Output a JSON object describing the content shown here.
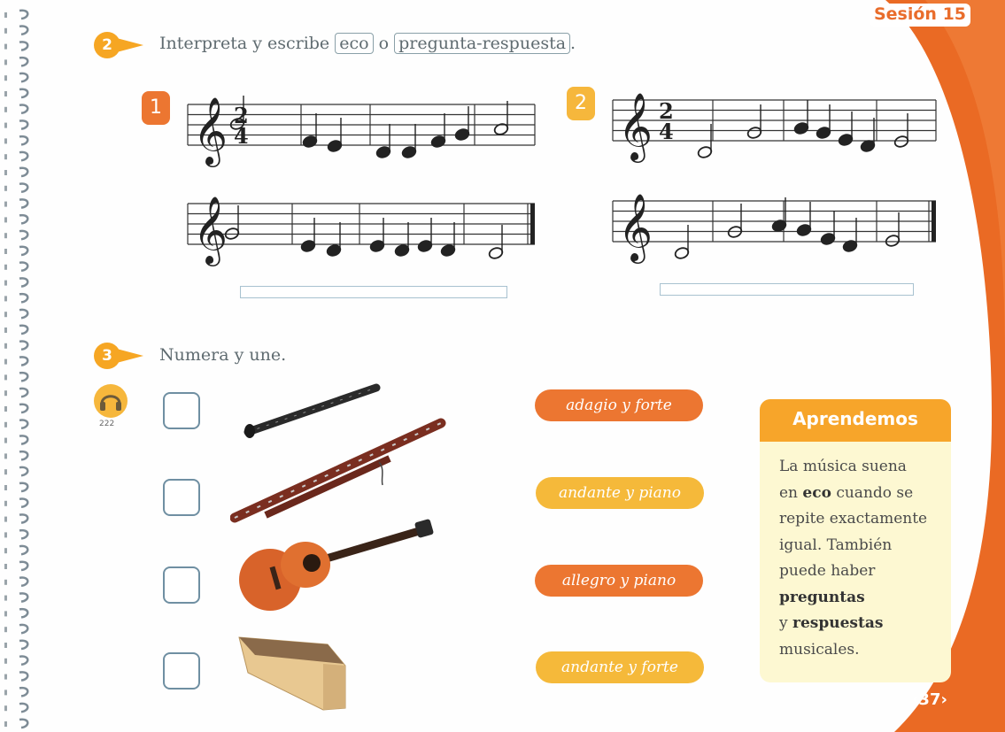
{
  "session_label": "Sesión 15",
  "activity2": {
    "number": "2",
    "instruction_prefix": "Interpreta y escribe",
    "option_eco": "eco",
    "conjunction": "o",
    "option_qa": "pregunta-respuesta",
    "instruction_suffix": ".",
    "exercises": [
      {
        "number": "1"
      },
      {
        "number": "2"
      }
    ],
    "time_signature_top": "2",
    "time_signature_bottom": "4"
  },
  "activity3": {
    "number": "3",
    "instruction": "Numera y une.",
    "track": "222",
    "instruments": [
      {
        "name": "clarinet-image"
      },
      {
        "name": "bassoon-image"
      },
      {
        "name": "guitar-image"
      },
      {
        "name": "xylophone-image"
      }
    ],
    "tempo_labels": [
      "adagio y forte",
      "andante y piano",
      "allegro y piano",
      "andante y forte"
    ]
  },
  "aprendemos": {
    "title": "Aprendemos",
    "t1": "La música suena",
    "t2a": "en ",
    "t2b": "eco",
    "t2c": " cuando se",
    "t3": "repite exactamente",
    "t4": "igual. También",
    "t5": "puede haber",
    "t6": "preguntas",
    "t7a": "y ",
    "t7b": "respuestas",
    "t8": "musicales."
  },
  "page_number": "‹37›",
  "colors": {
    "orange": "#ec7631",
    "yellow": "#f6a623",
    "light_yellow": "#fdf8d2"
  }
}
